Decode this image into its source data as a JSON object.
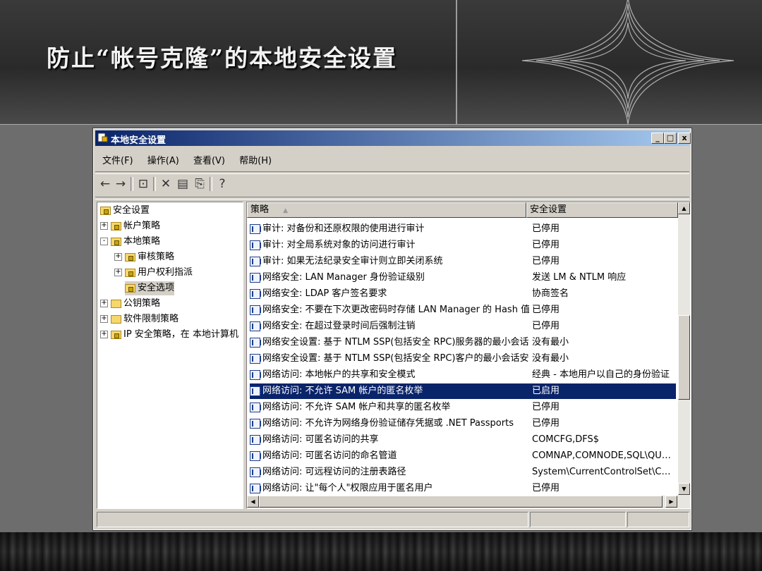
{
  "slide": {
    "title": "防止“帐号克隆”的本地安全设置"
  },
  "window": {
    "title": "本地安全设置",
    "controls": {
      "minimize": "_",
      "maximize": "□",
      "close": "x"
    }
  },
  "menu": [
    "文件(F)",
    "操作(A)",
    "查看(V)",
    "帮助(H)"
  ],
  "toolbar_icons": [
    "back-icon",
    "forward-icon",
    "up-folder-icon",
    "delete-icon",
    "properties-icon",
    "export-icon",
    "help-icon"
  ],
  "tree": [
    {
      "label": "安全设置",
      "expander": "",
      "icon": "security-settings-icon"
    },
    {
      "label": "帐户策略",
      "expander": "+",
      "icon": "folder-lock-icon"
    },
    {
      "label": "本地策略",
      "expander": "-",
      "icon": "folder-lock-icon"
    },
    {
      "label": "审核策略",
      "expander": "+",
      "icon": "folder-lock-icon"
    },
    {
      "label": "用户权利指派",
      "expander": "+",
      "icon": "folder-lock-icon"
    },
    {
      "label": "安全选项",
      "expander": "",
      "icon": "folder-lock-icon",
      "selected": true
    },
    {
      "label": "公钥策略",
      "expander": "+",
      "icon": "folder-icon"
    },
    {
      "label": "软件限制策略",
      "expander": "+",
      "icon": "folder-icon"
    },
    {
      "label": "IP 安全策略，在 本地计算机",
      "expander": "+",
      "icon": "ip-security-icon"
    }
  ],
  "list": {
    "columns": [
      "策略",
      "安全设置"
    ],
    "sort_indicator": "▲",
    "selected_index": 10,
    "rows": [
      {
        "policy": "审计: 对备份和还原权限的使用进行审计",
        "setting": "已停用"
      },
      {
        "policy": "审计: 对全局系统对象的访问进行审计",
        "setting": "已停用"
      },
      {
        "policy": "审计: 如果无法纪录安全审计则立即关闭系统",
        "setting": "已停用"
      },
      {
        "policy": "网络安全: LAN Manager 身份验证级别",
        "setting": "发送 LM & NTLM 响应"
      },
      {
        "policy": "网络安全: LDAP 客户签名要求",
        "setting": "协商签名"
      },
      {
        "policy": "网络安全: 不要在下次更改密码时存储 LAN Manager 的 Hash 值",
        "setting": "已停用"
      },
      {
        "policy": "网络安全: 在超过登录时间后强制注销",
        "setting": "已停用"
      },
      {
        "policy": "网络安全设置: 基于 NTLM SSP(包括安全 RPC)服务器的最小会话安全",
        "setting": "没有最小"
      },
      {
        "policy": "网络安全设置: 基于 NTLM SSP(包括安全 RPC)客户的最小会话安全",
        "setting": "没有最小"
      },
      {
        "policy": "网络访问: 本地帐户的共享和安全模式",
        "setting": "经典 - 本地用户以自己的身份验证"
      },
      {
        "policy": "网络访问: 不允许 SAM 帐户的匿名枚举",
        "setting": "已启用"
      },
      {
        "policy": "网络访问: 不允许 SAM 帐户和共享的匿名枚举",
        "setting": "已停用"
      },
      {
        "policy": "网络访问: 不允许为网络身份验证储存凭据或 .NET Passports",
        "setting": "已停用"
      },
      {
        "policy": "网络访问: 可匿名访问的共享",
        "setting": "COMCFG,DFS$"
      },
      {
        "policy": "网络访问: 可匿名访问的命名管道",
        "setting": "COMNAP,COMNODE,SQL\\QUERY,SP..."
      },
      {
        "policy": "网络访问: 可远程访问的注册表路径",
        "setting": "System\\CurrentControlSet\\Control\\Pr..."
      },
      {
        "policy": "网络访问: 让\"每个人\"权限应用于匿名用户",
        "setting": "已停用"
      }
    ]
  },
  "scroll_arrows": {
    "up": "▲",
    "down": "▼",
    "left": "◀",
    "right": "▶"
  }
}
